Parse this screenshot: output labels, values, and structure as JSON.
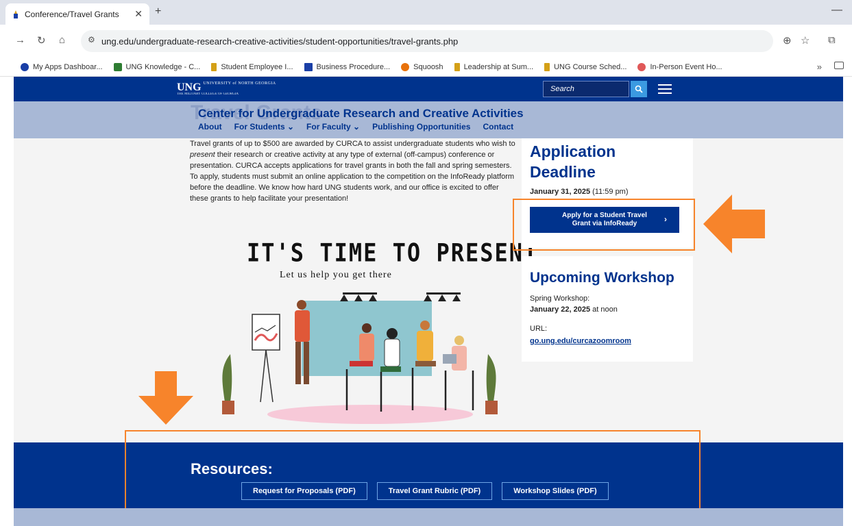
{
  "browser": {
    "tab_title": "Conference/Travel Grants",
    "url": "ung.edu/undergraduate-research-creative-activities/student-opportunities/travel-grants.php",
    "bookmarks": [
      {
        "label": "My Apps Dashboar...",
        "color": "#1a3fa6"
      },
      {
        "label": "UNG Knowledge - C...",
        "color": "#2e7d32"
      },
      {
        "label": "Student Employee I...",
        "color": "#d4a017"
      },
      {
        "label": "Business Procedure...",
        "color": "#1a3fa6"
      },
      {
        "label": "Squoosh",
        "color": "#e8710a"
      },
      {
        "label": "Leadership at Sum...",
        "color": "#d4a017"
      },
      {
        "label": "UNG Course Sched...",
        "color": "#d4a017"
      },
      {
        "label": "In-Person Event Ho...",
        "color": "#e05858"
      }
    ]
  },
  "site": {
    "logo_main": "UNG",
    "logo_small": "UNIVERSITY of NORTH GEORGIA",
    "logo_sub": "THE MILITARY COLLEGE OF GEORGIA",
    "search_placeholder": "Search",
    "ghost_heading": "Travel Grants",
    "dept_title": "Center for Undergraduate Research and Creative Activities",
    "nav": [
      "About",
      "For Students ⌄",
      "For Faculty ⌄",
      "Publishing Opportunities",
      "Contact"
    ]
  },
  "main": {
    "intro_1": "Travel grants of up to $500 are awarded by CURCA to assist undergraduate students who wish to ",
    "intro_em": "present",
    "intro_2": " their research or creative activity at any type of external (off-campus) conference or presentation. CURCA accepts applications for travel grants in both the fall and spring semesters. To apply, students must submit an online application to the competition on the InfoReady platform before the deadline. We know how hard UNG students work, and our office is excited to offer these grants to help facilitate your presentation!",
    "hero_heading": "IT'S TIME TO PRESENT",
    "hero_sub": "Let us help you get there"
  },
  "deadline": {
    "heading": "Application Deadline",
    "date_bold": "January 31, 2025",
    "date_rest": " (11:59 pm)",
    "apply_label": "Apply for a Student Travel Grant via InfoReady"
  },
  "workshop": {
    "heading": "Upcoming Workshop",
    "label": "Spring Workshop:",
    "date_bold": "January 22, 2025",
    "date_rest": " at noon",
    "url_label": "URL:",
    "url": "go.ung.edu/curcazoomroom"
  },
  "resources": {
    "heading": "Resources:",
    "buttons": [
      "Request for Proposals (PDF)",
      "Travel Grant Rubric (PDF)",
      "Workshop Slides (PDF)"
    ]
  },
  "colors": {
    "brand_blue": "#00338d",
    "highlight_orange": "#f7842b"
  }
}
